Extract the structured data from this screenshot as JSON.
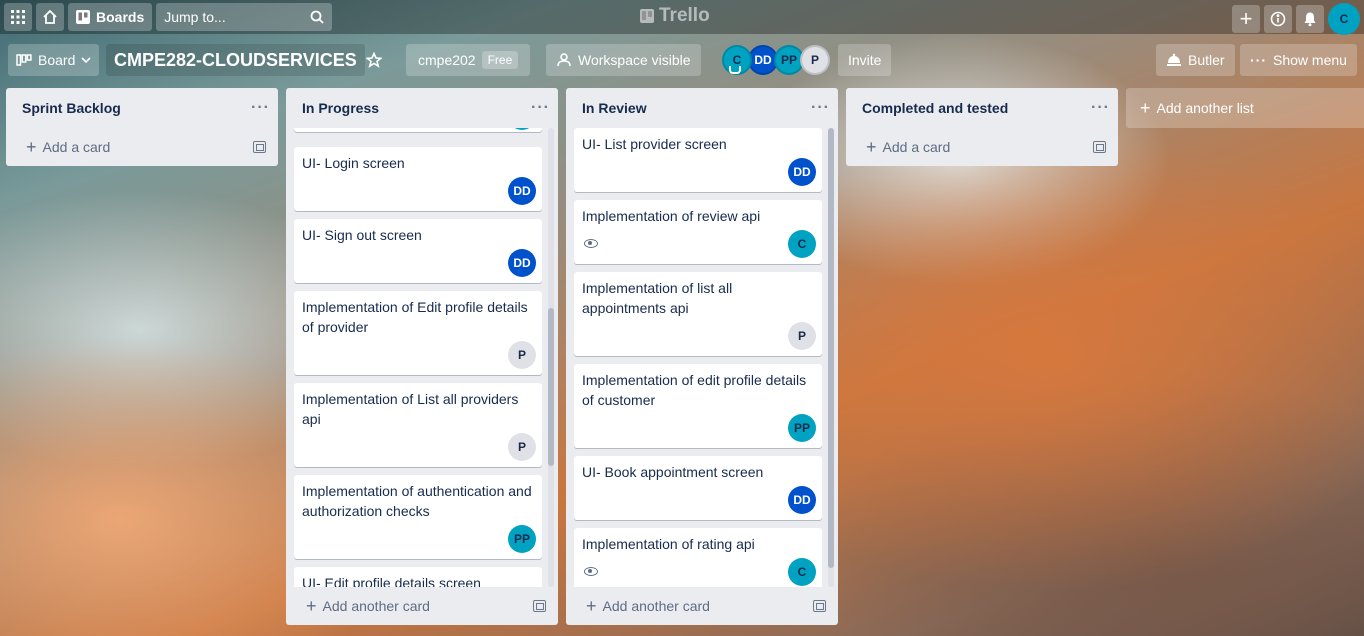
{
  "topbar": {
    "boards_label": "Boards",
    "search_placeholder": "Jump to...",
    "logo_text": "Trello",
    "user_initial": "C"
  },
  "board": {
    "view_label": "Board",
    "title": "CMPE282-CLOUDSERVICES",
    "workspace": "cmpe202",
    "plan_badge": "Free",
    "visibility_label": "Workspace visible",
    "members": [
      {
        "initials": "C",
        "color": "#00a2c1"
      },
      {
        "initials": "DD",
        "color": "#0052cc"
      },
      {
        "initials": "PP",
        "color": "#00a2c1"
      },
      {
        "initials": "P",
        "color": "#dfe1e6"
      }
    ],
    "invite_label": "Invite",
    "butler_label": "Butler",
    "show_menu_label": "Show menu"
  },
  "lists": {
    "backlog": {
      "title": "Sprint Backlog",
      "footer": "Add a card"
    },
    "progress": {
      "title": "In Progress",
      "footer": "Add another card",
      "cards": [
        {
          "text": "UI- Login screen",
          "member": "DD"
        },
        {
          "text": "UI- Sign out screen",
          "member": "DD"
        },
        {
          "text": "Implementation of Edit profile details of provider",
          "member": "P"
        },
        {
          "text": "Implementation of List all providers api",
          "member": "P"
        },
        {
          "text": "Implementation of authentication and authorization checks",
          "member": "PP"
        },
        {
          "text": "UI- Edit profile details screen",
          "member": ""
        }
      ]
    },
    "review": {
      "title": "In Review",
      "footer": "Add another card",
      "cards": [
        {
          "text": "UI- List provider screen",
          "member": "DD"
        },
        {
          "text": "Implementation of review api",
          "member": "C"
        },
        {
          "text": "Implementation of list all appointments api",
          "member": "P"
        },
        {
          "text": "Implementation of edit profile details of customer",
          "member": "PP"
        },
        {
          "text": "UI- Book appointment screen",
          "member": "DD"
        },
        {
          "text": "Implementation of rating api",
          "member": "C"
        }
      ]
    },
    "completed": {
      "title": "Completed and tested",
      "footer": "Add a card"
    }
  },
  "add_list_label": "Add another list",
  "colors": {
    "teal": "#00a2c1",
    "blue": "#0052cc",
    "list_bg": "#ebecf0"
  }
}
